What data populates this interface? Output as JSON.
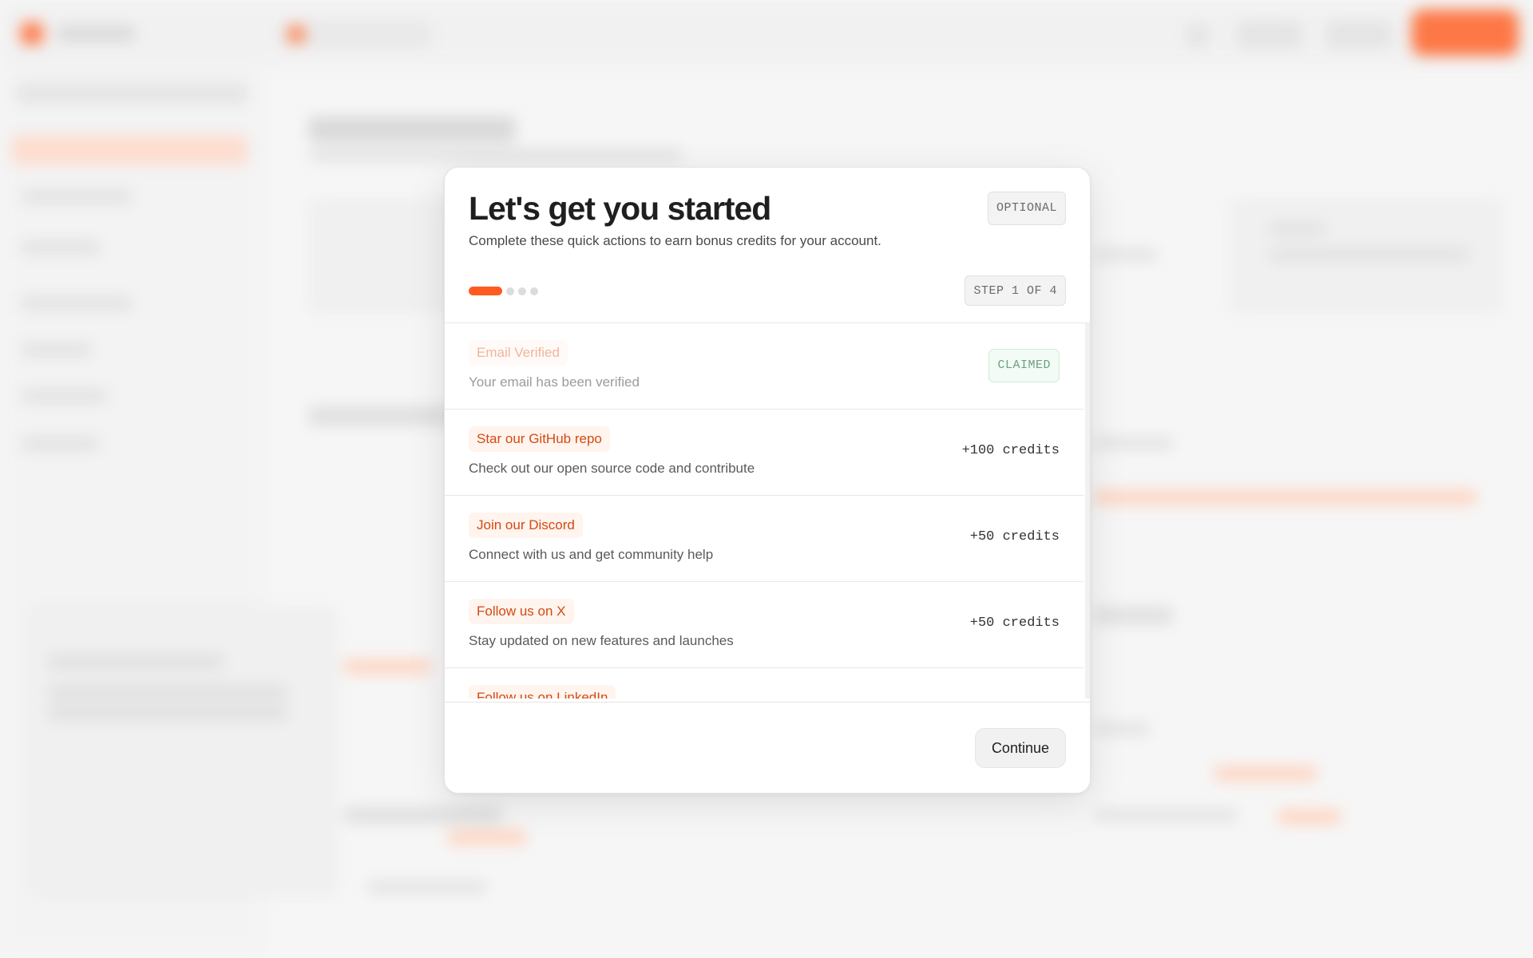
{
  "modal": {
    "title": "Let's get you started",
    "subtitle": "Complete these quick actions to earn bonus credits for your account.",
    "optional_badge": "OPTIONAL",
    "step_indicator": "STEP 1 OF 4",
    "progress": {
      "current_step": 1,
      "total_steps": 4
    },
    "continue_label": "Continue"
  },
  "tasks": [
    {
      "title": "Email Verified",
      "description": "Your email has been verified",
      "status": "CLAIMED"
    },
    {
      "title": "Star our GitHub repo",
      "description": "Check out our open source code and contribute",
      "reward": "+100 credits"
    },
    {
      "title": "Join our Discord",
      "description": "Connect with us and get community help",
      "reward": "+50 credits"
    },
    {
      "title": "Follow us on X",
      "description": "Stay updated on new features and launches",
      "reward": "+50 credits"
    },
    {
      "title": "Follow us on LinkedIn"
    }
  ],
  "colors": {
    "accent": "#ff5a1f",
    "task_title": "#d34a12",
    "claimed_green": "#6f9f80",
    "background": "#f6f6f6"
  }
}
